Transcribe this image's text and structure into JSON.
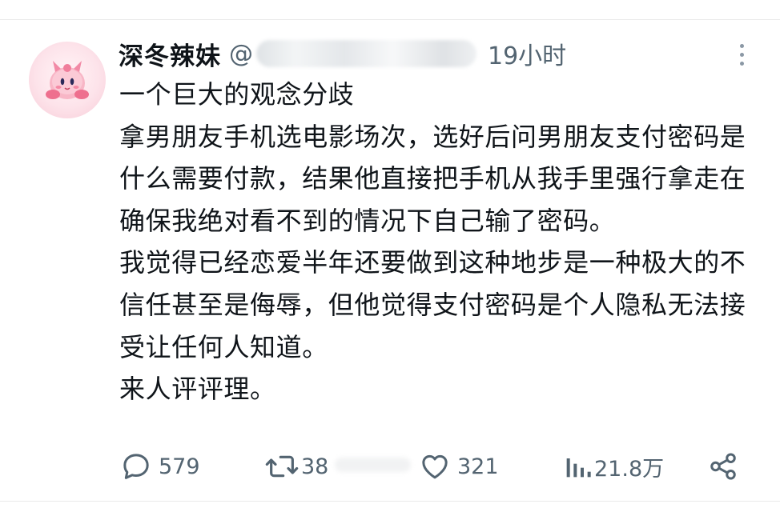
{
  "post": {
    "author_name": "深冬辣妹",
    "handle_prefix": "@",
    "timestamp": "19小时",
    "paragraphs": [
      "一个巨大的观念分歧",
      "拿男朋友手机选电影场次，选好后问男朋友支付密码是什么需要付款，结果他直接把手机从我手里强行拿走在确保我绝对看不到的情况下自己输了密码。",
      "我觉得已经恋爱半年还要做到这种地步是一种极大的不信任甚至是侮辱，但他觉得支付密码是个人隐私无法接受让任何人知道。",
      "来人评评理。"
    ]
  },
  "actions": {
    "reply": {
      "icon": "reply-icon",
      "count": "579"
    },
    "repost": {
      "icon": "repost-icon",
      "count": "38"
    },
    "like": {
      "icon": "heart-icon",
      "count": "321"
    },
    "views": {
      "icon": "views-icon",
      "count": "21.8万"
    },
    "share": {
      "icon": "share-icon"
    }
  },
  "colors": {
    "text": "#0f1419",
    "secondary": "#536471",
    "avatar_pink": "#f4a7bb"
  }
}
